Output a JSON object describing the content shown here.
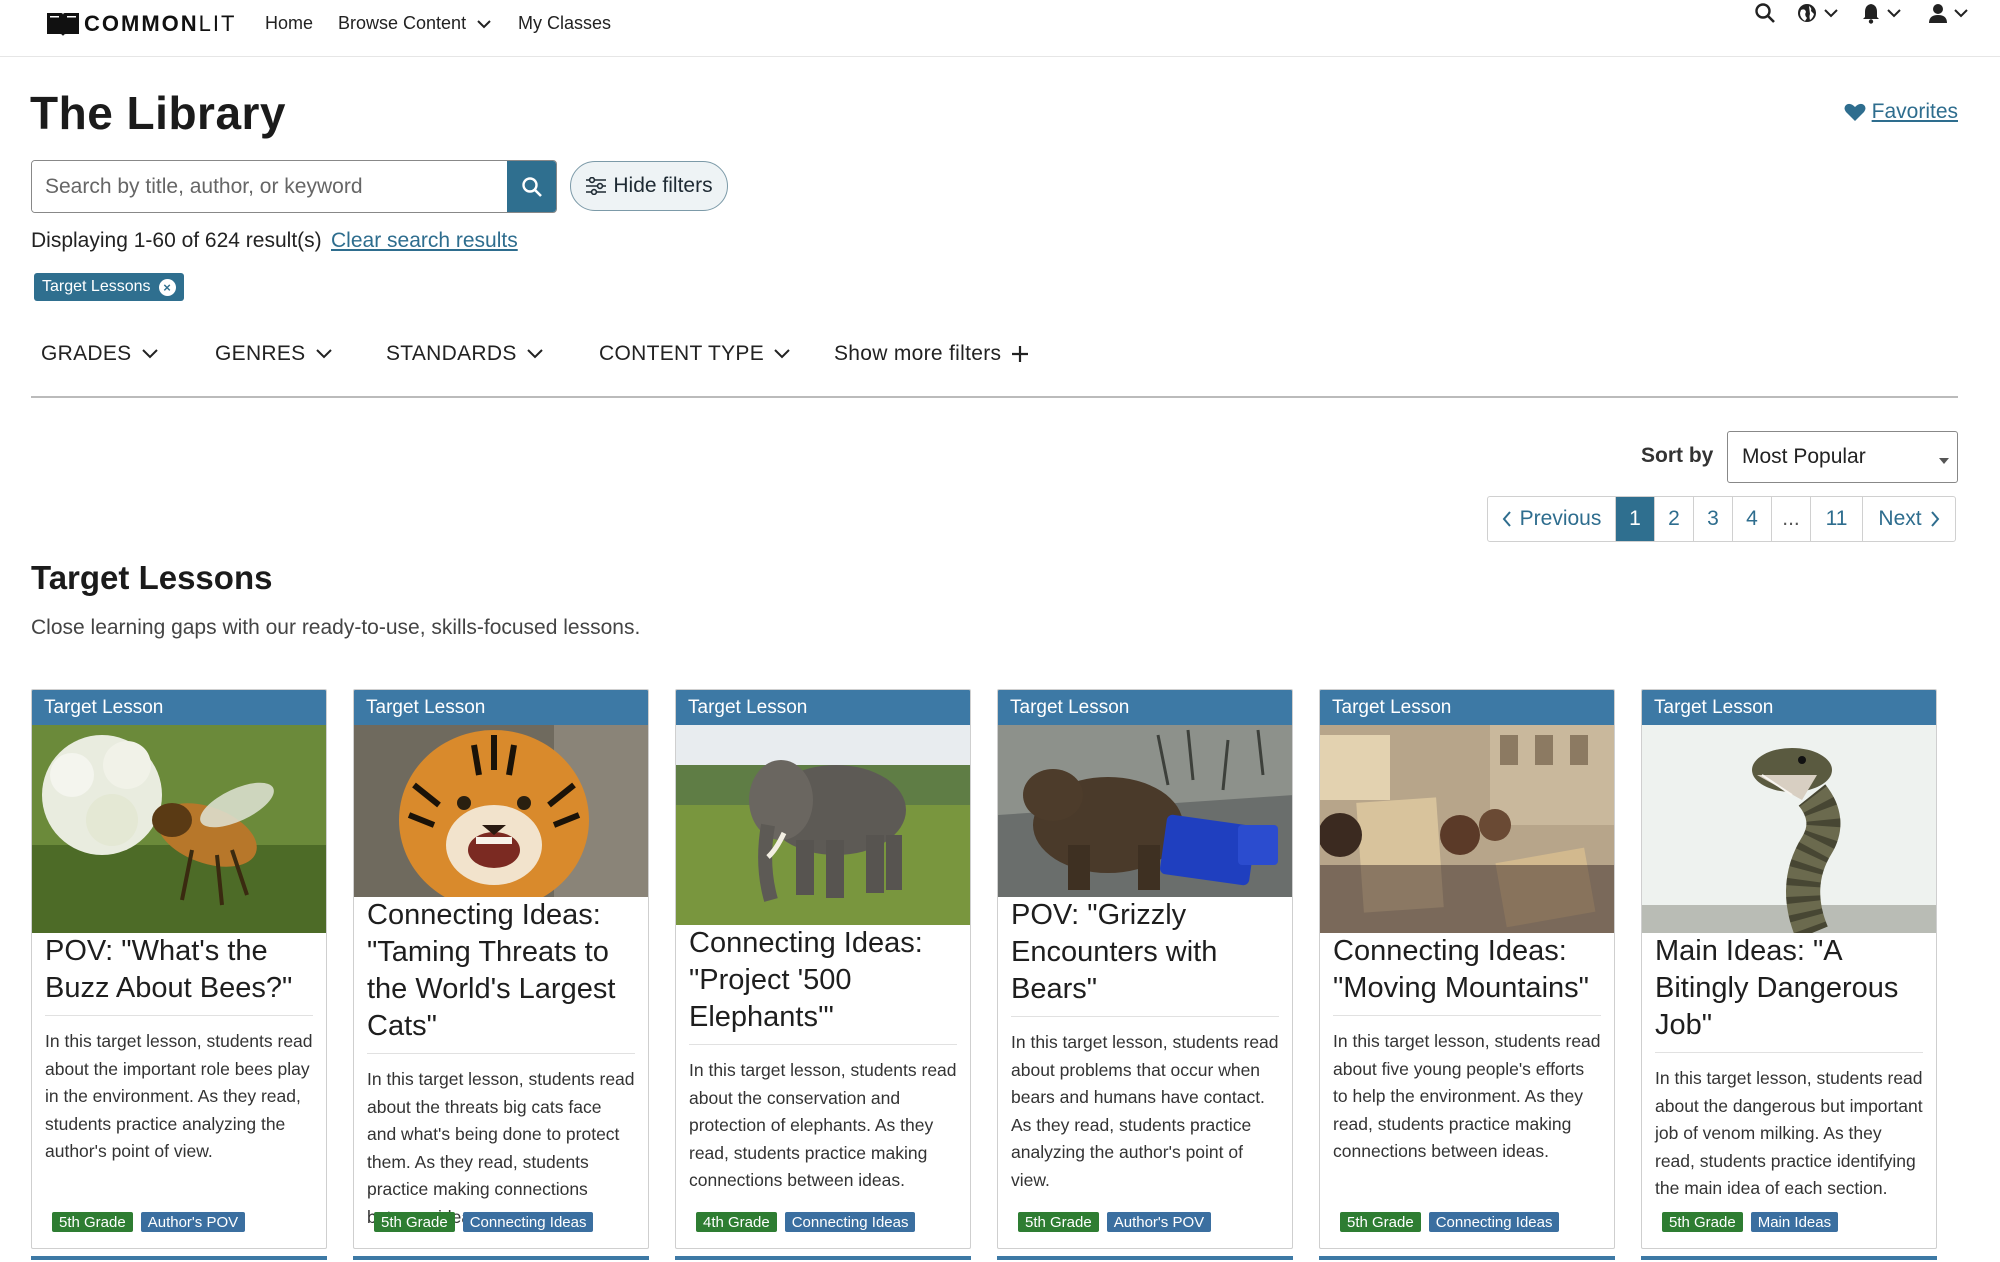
{
  "nav": {
    "logo_text_a": "COMMON",
    "logo_text_b": "LIT",
    "home": "Home",
    "browse": "Browse Content",
    "my_classes": "My Classes"
  },
  "header": {
    "title": "The Library",
    "favorites": "Favorites"
  },
  "search": {
    "placeholder": "Search by title, author, or keyword",
    "hide_filters": "Hide filters"
  },
  "results": {
    "display_text": "Displaying 1-60 of 624 result(s)",
    "clear": "Clear search results",
    "active_chip": "Target Lessons"
  },
  "filters": [
    "GRADES",
    "GENRES",
    "STANDARDS",
    "CONTENT TYPE",
    "Show more filters"
  ],
  "sort": {
    "label": "Sort by",
    "value": "Most Popular"
  },
  "pagination": {
    "prev": "Previous",
    "pages": [
      "1",
      "2",
      "3",
      "4",
      "...",
      "11"
    ],
    "current": "1",
    "next": "Next"
  },
  "section": {
    "title": "Target Lessons",
    "description": "Close learning gaps with our ready-to-use, skills-focused lessons."
  },
  "cards": [
    {
      "header": "Target Lesson",
      "title": "POV: \"What's the Buzz About Bees?\"",
      "description": "In this target lesson, students read about the important role bees play in the environment. As they read, students practice analyzing the author's point of view.",
      "grade": "5th Grade",
      "skill": "Author's POV",
      "image": "bee-on-flower"
    },
    {
      "header": "Target Lesson",
      "title": "Connecting Ideas: \"Taming Threats to the World's Largest Cats\"",
      "description": "In this target lesson, students read about the threats big cats face and what's being done to protect them. As they read, students practice making connections between ideas.",
      "grade": "5th Grade",
      "skill": "Connecting Ideas",
      "image": "tiger"
    },
    {
      "header": "Target Lesson",
      "title": "Connecting Ideas: \"Project '500 Elephants'\"",
      "description": "In this target lesson, students read about the conservation and protection of elephants. As they read, students practice making connections between ideas.",
      "grade": "4th Grade",
      "skill": "Connecting Ideas",
      "image": "elephant"
    },
    {
      "header": "Target Lesson",
      "title": "POV: \"Grizzly Encounters with Bears\"",
      "description": "In this target lesson, students read about problems that occur when bears and humans have contact. As they read, students practice analyzing the author's point of view.",
      "grade": "5th Grade",
      "skill": "Author's POV",
      "image": "bear-trash-bin"
    },
    {
      "header": "Target Lesson",
      "title": "Connecting Ideas: \"Moving Mountains\"",
      "description": "In this target lesson, students read about five young people's efforts to help the environment. As they read, students practice making connections between ideas.",
      "grade": "5th Grade",
      "skill": "Connecting Ideas",
      "image": "climate-protest"
    },
    {
      "header": "Target Lesson",
      "title": "Main Ideas: \"A Bitingly Dangerous Job\"",
      "description": "In this target lesson, students read about the dangerous but important job of venom milking. As they read, students practice identifying the main idea of each section.",
      "grade": "5th Grade",
      "skill": "Main Ideas",
      "image": "snake"
    }
  ],
  "colors": {
    "brand_teal": "#2f6f8f",
    "card_header": "#3d79a5",
    "grade_tag": "#2e7d32",
    "skill_tag": "#3b6fa0",
    "link": "#2e6d8e"
  }
}
